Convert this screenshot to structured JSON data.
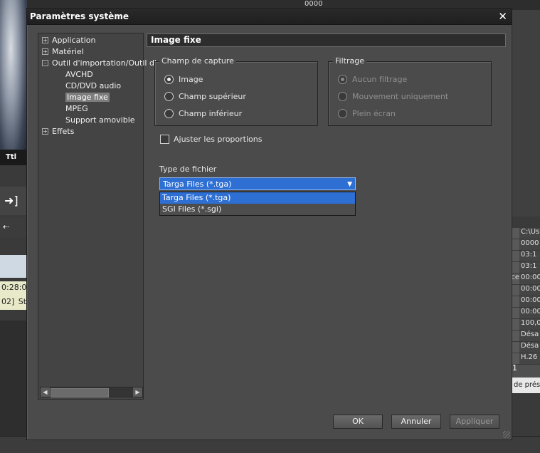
{
  "background": {
    "timecode_short": "Ttl",
    "clip_timecode": "0:28:0",
    "clip_label": "02]",
    "clip_label_suffix": "St",
    "top_counter": "0000",
    "properties": [
      {
        "k": "",
        "v": "C:\\Us"
      },
      {
        "k": "",
        "v": "0000"
      },
      {
        "k": "",
        "v": "03:1"
      },
      {
        "k": "",
        "v": "03:1"
      },
      {
        "k": "ce",
        "v": "00:00"
      },
      {
        "k": "",
        "v": "00:00"
      },
      {
        "k": "",
        "v": "00:00"
      },
      {
        "k": "",
        "v": "00:00"
      },
      {
        "k": "",
        "v": "100,0"
      },
      {
        "k": "",
        "v": "Désa"
      },
      {
        "k": "",
        "v": "Désa"
      },
      {
        "k": "",
        "v": "H.26"
      }
    ],
    "page_number": "1",
    "presets_label": "l de prés"
  },
  "dialog": {
    "title": "Paramètres système",
    "close_icon": "close-icon",
    "tree": [
      {
        "label": "Application",
        "level": 0,
        "expander": "+"
      },
      {
        "label": "Matériel",
        "level": 0,
        "expander": "+"
      },
      {
        "label": "Outil d'importation/Outil d'",
        "level": 0,
        "expander": "-"
      },
      {
        "label": "AVCHD",
        "level": 1
      },
      {
        "label": "CD/DVD audio",
        "level": 1
      },
      {
        "label": "Image fixe",
        "level": 1,
        "selected": true
      },
      {
        "label": "MPEG",
        "level": 1
      },
      {
        "label": "Support amovible",
        "level": 1
      },
      {
        "label": "Effets",
        "level": 0,
        "expander": "+"
      }
    ],
    "section_title": "Image fixe",
    "capture": {
      "legend": "Champ de capture",
      "options": [
        {
          "label": "Image",
          "checked": true
        },
        {
          "label": "Champ supérieur",
          "checked": false
        },
        {
          "label": "Champ inférieur",
          "checked": false
        }
      ]
    },
    "filter": {
      "legend": "Filtrage",
      "options": [
        {
          "label": "Aucun filtrage",
          "checked": true
        },
        {
          "label": "Mouvement uniquement",
          "checked": false
        },
        {
          "label": "Plein écran",
          "checked": false
        }
      ]
    },
    "aspect_checkbox": {
      "label": "Ajuster les proportions",
      "checked": false
    },
    "file_type": {
      "label": "Type de fichier",
      "selected": "Targa Files (*.tga)",
      "options": [
        "Targa Files (*.tga)",
        "SGI Files (*.sgi)"
      ]
    },
    "buttons": {
      "ok": "OK",
      "cancel": "Annuler",
      "apply": "Appliquer"
    },
    "accent_color": "#2e6fd4"
  }
}
